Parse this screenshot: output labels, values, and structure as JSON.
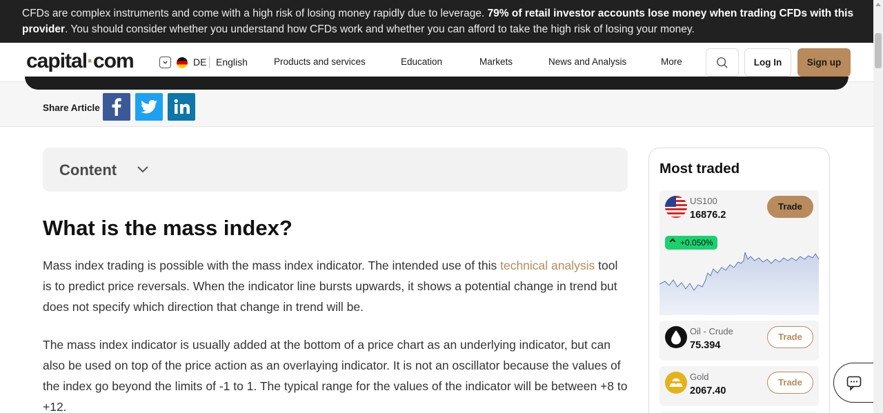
{
  "risk_banner": {
    "text_start": "CFDs are complex instruments and come with a high risk of losing money rapidly due to leverage. ",
    "text_bold": "79% of retail investor accounts lose money when trading CFDs with this provider",
    "text_end": ". You should consider whether you understand how CFDs work and whether you can afford to take the high risk of losing your money."
  },
  "header": {
    "logo_part1": "capital",
    "logo_dot": "·",
    "logo_part2": "com",
    "lang_code": "DE",
    "lang_name": "English",
    "nav": [
      "Products and services",
      "Education",
      "Markets",
      "News and Analysis",
      "More"
    ],
    "login_label": "Log In",
    "signup_label": "Sign up"
  },
  "share": {
    "label": "Share Article"
  },
  "content_toggle": {
    "label": "Content"
  },
  "article": {
    "heading": "What is the mass index?",
    "p1_start": "Mass index trading is possible with the mass index indicator. The intended use of this ",
    "p1_link": "technical analysis",
    "p1_end": " tool is to predict price reversals. When the indicator line bursts upwards, it shows a potential change in trend but does not specify which direction that change in trend will be.",
    "p2": "The mass index indicator is usually added at the bottom of a price chart as an underlying  indicator, but can also be used on top of the price action as an overlaying indicator. It is not an oscillator because the values of the index go beyond the limits of -1 to 1. The typical range for the values of the indicator will be between +8 to +12."
  },
  "sidebar": {
    "title": "Most traded",
    "instruments": [
      {
        "name": "US100",
        "price": "16876.2",
        "change": "+0.050%",
        "trade_label": "Trade"
      },
      {
        "name": "Oil - Crude",
        "price": "75.394",
        "trade_label": "Trade"
      },
      {
        "name": "Gold",
        "price": "2067.40",
        "trade_label": "Trade"
      }
    ]
  },
  "colors": {
    "accent": "#b88a5c",
    "positive": "#1ad170",
    "banner_bg": "#212121"
  },
  "icons": {
    "search": "search-icon",
    "chat": "chat-icon",
    "chevron": "chevron-down-icon"
  }
}
